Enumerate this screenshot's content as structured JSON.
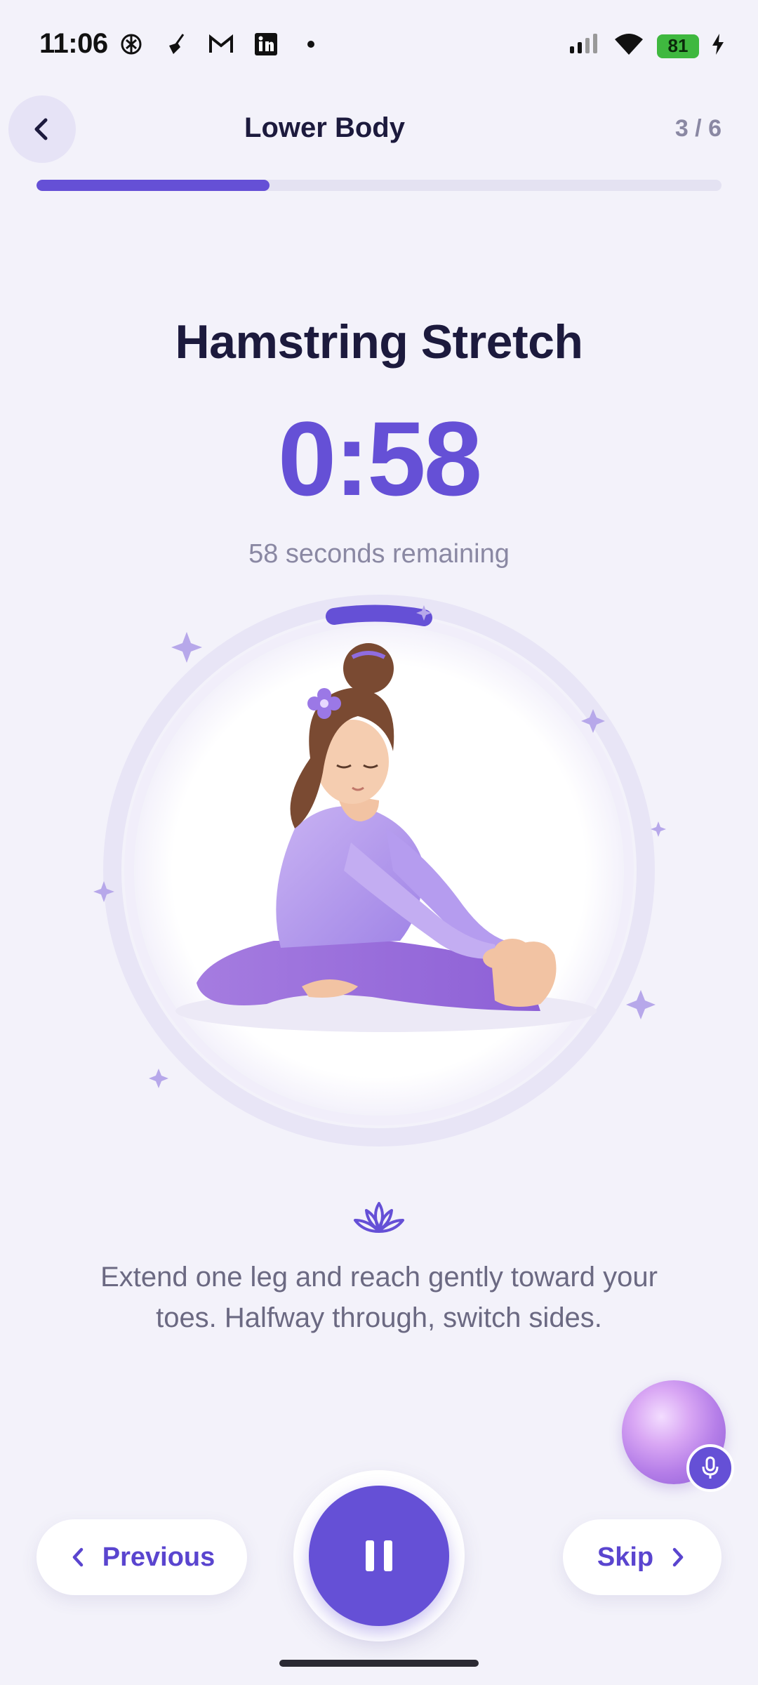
{
  "status_bar": {
    "time": "11:06",
    "battery": "81",
    "left_icons": [
      "chatgpt-icon",
      "broom-icon",
      "gmail-icon",
      "linkedin-icon",
      "dot-icon"
    ],
    "right_icons": [
      "signal-icon",
      "wifi-icon",
      "battery-icon",
      "charging-icon"
    ]
  },
  "header": {
    "title": "Lower Body",
    "step_counter": "3 / 6",
    "progress_fraction": 0.34
  },
  "exercise": {
    "title": "Hamstring Stretch",
    "timer": "0:58",
    "remaining": "58 seconds remaining",
    "timer_ring_fraction": 0.05,
    "illustration": "woman-seated-hamstring-stretch"
  },
  "instruction": {
    "text": "Extend one leg and reach gently toward your toes. Halfway through, switch sides."
  },
  "controls": {
    "previous_label": "Previous",
    "skip_label": "Skip",
    "pause_icon": "pause-icon"
  },
  "colors": {
    "accent": "#6550d6",
    "background": "#f3f2fa",
    "title": "#1c1a3d",
    "muted": "#8a88a3"
  }
}
